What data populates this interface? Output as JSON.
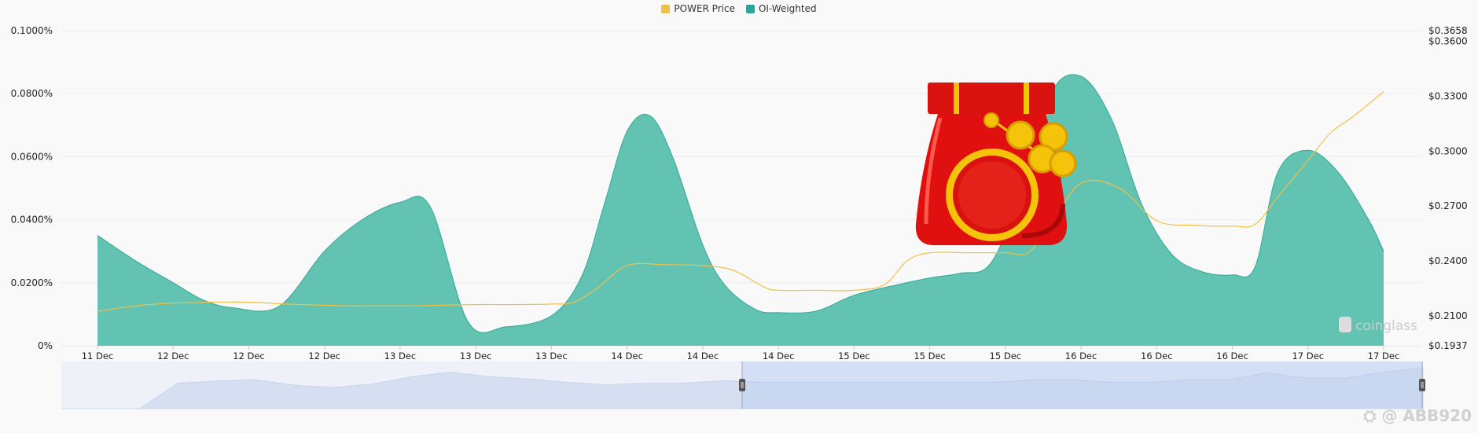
{
  "legend": {
    "items": [
      {
        "label": "POWER Price",
        "color": "#f0c04a"
      },
      {
        "label": "OI-Weighted",
        "color": "#26a69a"
      }
    ]
  },
  "watermark": {
    "text": "coinglass"
  },
  "user_watermark": {
    "text": "⛭ @ ABB920"
  },
  "chart_data": {
    "type": "area",
    "x_labels": [
      "11 Dec",
      "12 Dec",
      "12 Dec",
      "12 Dec",
      "13 Dec",
      "13 Dec",
      "13 Dec",
      "14 Dec",
      "14 Dec",
      "14 Dec",
      "15 Dec",
      "15 Dec",
      "15 Dec",
      "16 Dec",
      "16 Dec",
      "16 Dec",
      "17 Dec",
      "17 Dec"
    ],
    "y_left": {
      "ticks": [
        "0%",
        "0.0200%",
        "0.0400%",
        "0.0600%",
        "0.0800%",
        "0.1000%"
      ],
      "range": [
        0,
        0.1
      ]
    },
    "y_right": {
      "ticks": [
        "$0.1937",
        "$0.2100",
        "$0.2400",
        "$0.2700",
        "$0.3000",
        "$0.3300",
        "$0.3600",
        "$0.3658"
      ],
      "values": [
        0.1937,
        0.21,
        0.24,
        0.27,
        0.3,
        0.33,
        0.36,
        0.3658
      ],
      "range": [
        0.1937,
        0.3658
      ]
    },
    "grid": true,
    "legend_position": "top-center",
    "series": [
      {
        "name": "OI-Weighted",
        "axis": "left",
        "color": "#26a69a",
        "x": [
          0,
          0.5,
          1,
          1.4,
          1.8,
          2.4,
          3,
          3.5,
          4,
          4.4,
          4.9,
          5.4,
          6,
          6.4,
          6.7,
          7,
          7.3,
          7.6,
          8,
          8.3,
          8.7,
          9,
          9.5,
          10,
          10.6,
          11,
          11.4,
          11.8,
          12.2,
          12.6,
          13,
          13.4,
          13.8,
          14.2,
          14.6,
          15,
          15.3,
          15.6,
          16,
          16.4,
          16.8,
          17
        ],
        "values": [
          0.035,
          0.027,
          0.02,
          0.0145,
          0.012,
          0.0125,
          0.03,
          0.04,
          0.0455,
          0.044,
          0.0075,
          0.006,
          0.0095,
          0.022,
          0.045,
          0.068,
          0.073,
          0.06,
          0.032,
          0.019,
          0.0115,
          0.0105,
          0.011,
          0.016,
          0.0195,
          0.0215,
          0.023,
          0.026,
          0.048,
          0.08,
          0.0855,
          0.072,
          0.045,
          0.029,
          0.0235,
          0.0225,
          0.025,
          0.055,
          0.062,
          0.055,
          0.04,
          0.03
        ]
      },
      {
        "name": "POWER Price",
        "axis": "right",
        "color": "#f0c04a",
        "x": [
          0,
          0.5,
          1,
          1.5,
          2,
          2.5,
          3,
          3.5,
          4,
          4.5,
          5,
          5.5,
          6,
          6.3,
          6.6,
          7,
          7.5,
          8,
          8.4,
          8.8,
          9,
          9.5,
          10,
          10.4,
          10.7,
          11,
          11.5,
          12,
          12.3,
          12.6,
          13,
          13.5,
          14,
          14.5,
          15,
          15.3,
          15.6,
          16,
          16.3,
          16.6,
          17
        ],
        "values": [
          0.2125,
          0.2155,
          0.217,
          0.2175,
          0.2175,
          0.2165,
          0.2158,
          0.2155,
          0.2155,
          0.2158,
          0.2162,
          0.2162,
          0.2165,
          0.2175,
          0.225,
          0.2375,
          0.238,
          0.2375,
          0.235,
          0.226,
          0.224,
          0.224,
          0.224,
          0.227,
          0.24,
          0.2445,
          0.2445,
          0.2445,
          0.2445,
          0.26,
          0.2825,
          0.28,
          0.262,
          0.2595,
          0.259,
          0.26,
          0.275,
          0.295,
          0.31,
          0.319,
          0.3325
        ]
      }
    ]
  },
  "navigator": {
    "values": [
      0.0,
      0.0,
      0.0,
      0.6,
      0.65,
      0.68,
      0.55,
      0.5,
      0.58,
      0.75,
      0.86,
      0.75,
      0.7,
      0.62,
      0.56,
      0.6,
      0.6,
      0.66,
      0.62,
      0.62,
      0.62,
      0.62,
      0.62,
      0.62,
      0.62,
      0.68,
      0.68,
      0.62,
      0.62,
      0.68,
      0.68,
      0.84,
      0.72,
      0.72,
      0.86,
      0.96
    ],
    "selection_start": 0.5,
    "selection_end": 1.0
  }
}
